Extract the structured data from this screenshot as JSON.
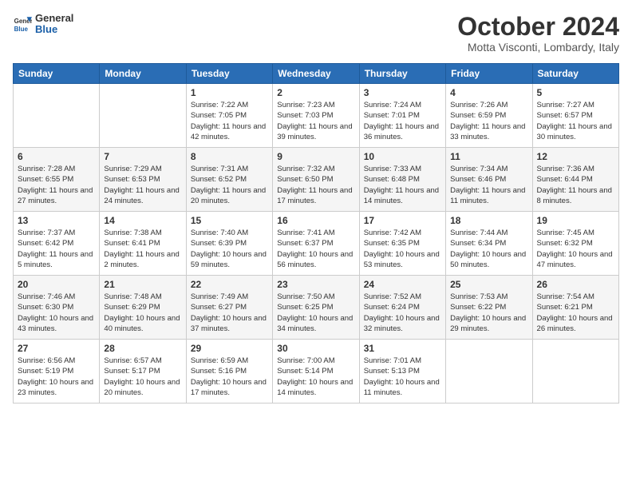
{
  "logo": {
    "line1": "General",
    "line2": "Blue"
  },
  "title": "October 2024",
  "subtitle": "Motta Visconti, Lombardy, Italy",
  "header": {
    "days": [
      "Sunday",
      "Monday",
      "Tuesday",
      "Wednesday",
      "Thursday",
      "Friday",
      "Saturday"
    ]
  },
  "weeks": [
    [
      {
        "day": "",
        "sunrise": "",
        "sunset": "",
        "daylight": ""
      },
      {
        "day": "",
        "sunrise": "",
        "sunset": "",
        "daylight": ""
      },
      {
        "day": "1",
        "sunrise": "Sunrise: 7:22 AM",
        "sunset": "Sunset: 7:05 PM",
        "daylight": "Daylight: 11 hours and 42 minutes."
      },
      {
        "day": "2",
        "sunrise": "Sunrise: 7:23 AM",
        "sunset": "Sunset: 7:03 PM",
        "daylight": "Daylight: 11 hours and 39 minutes."
      },
      {
        "day": "3",
        "sunrise": "Sunrise: 7:24 AM",
        "sunset": "Sunset: 7:01 PM",
        "daylight": "Daylight: 11 hours and 36 minutes."
      },
      {
        "day": "4",
        "sunrise": "Sunrise: 7:26 AM",
        "sunset": "Sunset: 6:59 PM",
        "daylight": "Daylight: 11 hours and 33 minutes."
      },
      {
        "day": "5",
        "sunrise": "Sunrise: 7:27 AM",
        "sunset": "Sunset: 6:57 PM",
        "daylight": "Daylight: 11 hours and 30 minutes."
      }
    ],
    [
      {
        "day": "6",
        "sunrise": "Sunrise: 7:28 AM",
        "sunset": "Sunset: 6:55 PM",
        "daylight": "Daylight: 11 hours and 27 minutes."
      },
      {
        "day": "7",
        "sunrise": "Sunrise: 7:29 AM",
        "sunset": "Sunset: 6:53 PM",
        "daylight": "Daylight: 11 hours and 24 minutes."
      },
      {
        "day": "8",
        "sunrise": "Sunrise: 7:31 AM",
        "sunset": "Sunset: 6:52 PM",
        "daylight": "Daylight: 11 hours and 20 minutes."
      },
      {
        "day": "9",
        "sunrise": "Sunrise: 7:32 AM",
        "sunset": "Sunset: 6:50 PM",
        "daylight": "Daylight: 11 hours and 17 minutes."
      },
      {
        "day": "10",
        "sunrise": "Sunrise: 7:33 AM",
        "sunset": "Sunset: 6:48 PM",
        "daylight": "Daylight: 11 hours and 14 minutes."
      },
      {
        "day": "11",
        "sunrise": "Sunrise: 7:34 AM",
        "sunset": "Sunset: 6:46 PM",
        "daylight": "Daylight: 11 hours and 11 minutes."
      },
      {
        "day": "12",
        "sunrise": "Sunrise: 7:36 AM",
        "sunset": "Sunset: 6:44 PM",
        "daylight": "Daylight: 11 hours and 8 minutes."
      }
    ],
    [
      {
        "day": "13",
        "sunrise": "Sunrise: 7:37 AM",
        "sunset": "Sunset: 6:42 PM",
        "daylight": "Daylight: 11 hours and 5 minutes."
      },
      {
        "day": "14",
        "sunrise": "Sunrise: 7:38 AM",
        "sunset": "Sunset: 6:41 PM",
        "daylight": "Daylight: 11 hours and 2 minutes."
      },
      {
        "day": "15",
        "sunrise": "Sunrise: 7:40 AM",
        "sunset": "Sunset: 6:39 PM",
        "daylight": "Daylight: 10 hours and 59 minutes."
      },
      {
        "day": "16",
        "sunrise": "Sunrise: 7:41 AM",
        "sunset": "Sunset: 6:37 PM",
        "daylight": "Daylight: 10 hours and 56 minutes."
      },
      {
        "day": "17",
        "sunrise": "Sunrise: 7:42 AM",
        "sunset": "Sunset: 6:35 PM",
        "daylight": "Daylight: 10 hours and 53 minutes."
      },
      {
        "day": "18",
        "sunrise": "Sunrise: 7:44 AM",
        "sunset": "Sunset: 6:34 PM",
        "daylight": "Daylight: 10 hours and 50 minutes."
      },
      {
        "day": "19",
        "sunrise": "Sunrise: 7:45 AM",
        "sunset": "Sunset: 6:32 PM",
        "daylight": "Daylight: 10 hours and 47 minutes."
      }
    ],
    [
      {
        "day": "20",
        "sunrise": "Sunrise: 7:46 AM",
        "sunset": "Sunset: 6:30 PM",
        "daylight": "Daylight: 10 hours and 43 minutes."
      },
      {
        "day": "21",
        "sunrise": "Sunrise: 7:48 AM",
        "sunset": "Sunset: 6:29 PM",
        "daylight": "Daylight: 10 hours and 40 minutes."
      },
      {
        "day": "22",
        "sunrise": "Sunrise: 7:49 AM",
        "sunset": "Sunset: 6:27 PM",
        "daylight": "Daylight: 10 hours and 37 minutes."
      },
      {
        "day": "23",
        "sunrise": "Sunrise: 7:50 AM",
        "sunset": "Sunset: 6:25 PM",
        "daylight": "Daylight: 10 hours and 34 minutes."
      },
      {
        "day": "24",
        "sunrise": "Sunrise: 7:52 AM",
        "sunset": "Sunset: 6:24 PM",
        "daylight": "Daylight: 10 hours and 32 minutes."
      },
      {
        "day": "25",
        "sunrise": "Sunrise: 7:53 AM",
        "sunset": "Sunset: 6:22 PM",
        "daylight": "Daylight: 10 hours and 29 minutes."
      },
      {
        "day": "26",
        "sunrise": "Sunrise: 7:54 AM",
        "sunset": "Sunset: 6:21 PM",
        "daylight": "Daylight: 10 hours and 26 minutes."
      }
    ],
    [
      {
        "day": "27",
        "sunrise": "Sunrise: 6:56 AM",
        "sunset": "Sunset: 5:19 PM",
        "daylight": "Daylight: 10 hours and 23 minutes."
      },
      {
        "day": "28",
        "sunrise": "Sunrise: 6:57 AM",
        "sunset": "Sunset: 5:17 PM",
        "daylight": "Daylight: 10 hours and 20 minutes."
      },
      {
        "day": "29",
        "sunrise": "Sunrise: 6:59 AM",
        "sunset": "Sunset: 5:16 PM",
        "daylight": "Daylight: 10 hours and 17 minutes."
      },
      {
        "day": "30",
        "sunrise": "Sunrise: 7:00 AM",
        "sunset": "Sunset: 5:14 PM",
        "daylight": "Daylight: 10 hours and 14 minutes."
      },
      {
        "day": "31",
        "sunrise": "Sunrise: 7:01 AM",
        "sunset": "Sunset: 5:13 PM",
        "daylight": "Daylight: 10 hours and 11 minutes."
      },
      {
        "day": "",
        "sunrise": "",
        "sunset": "",
        "daylight": ""
      },
      {
        "day": "",
        "sunrise": "",
        "sunset": "",
        "daylight": ""
      }
    ]
  ]
}
